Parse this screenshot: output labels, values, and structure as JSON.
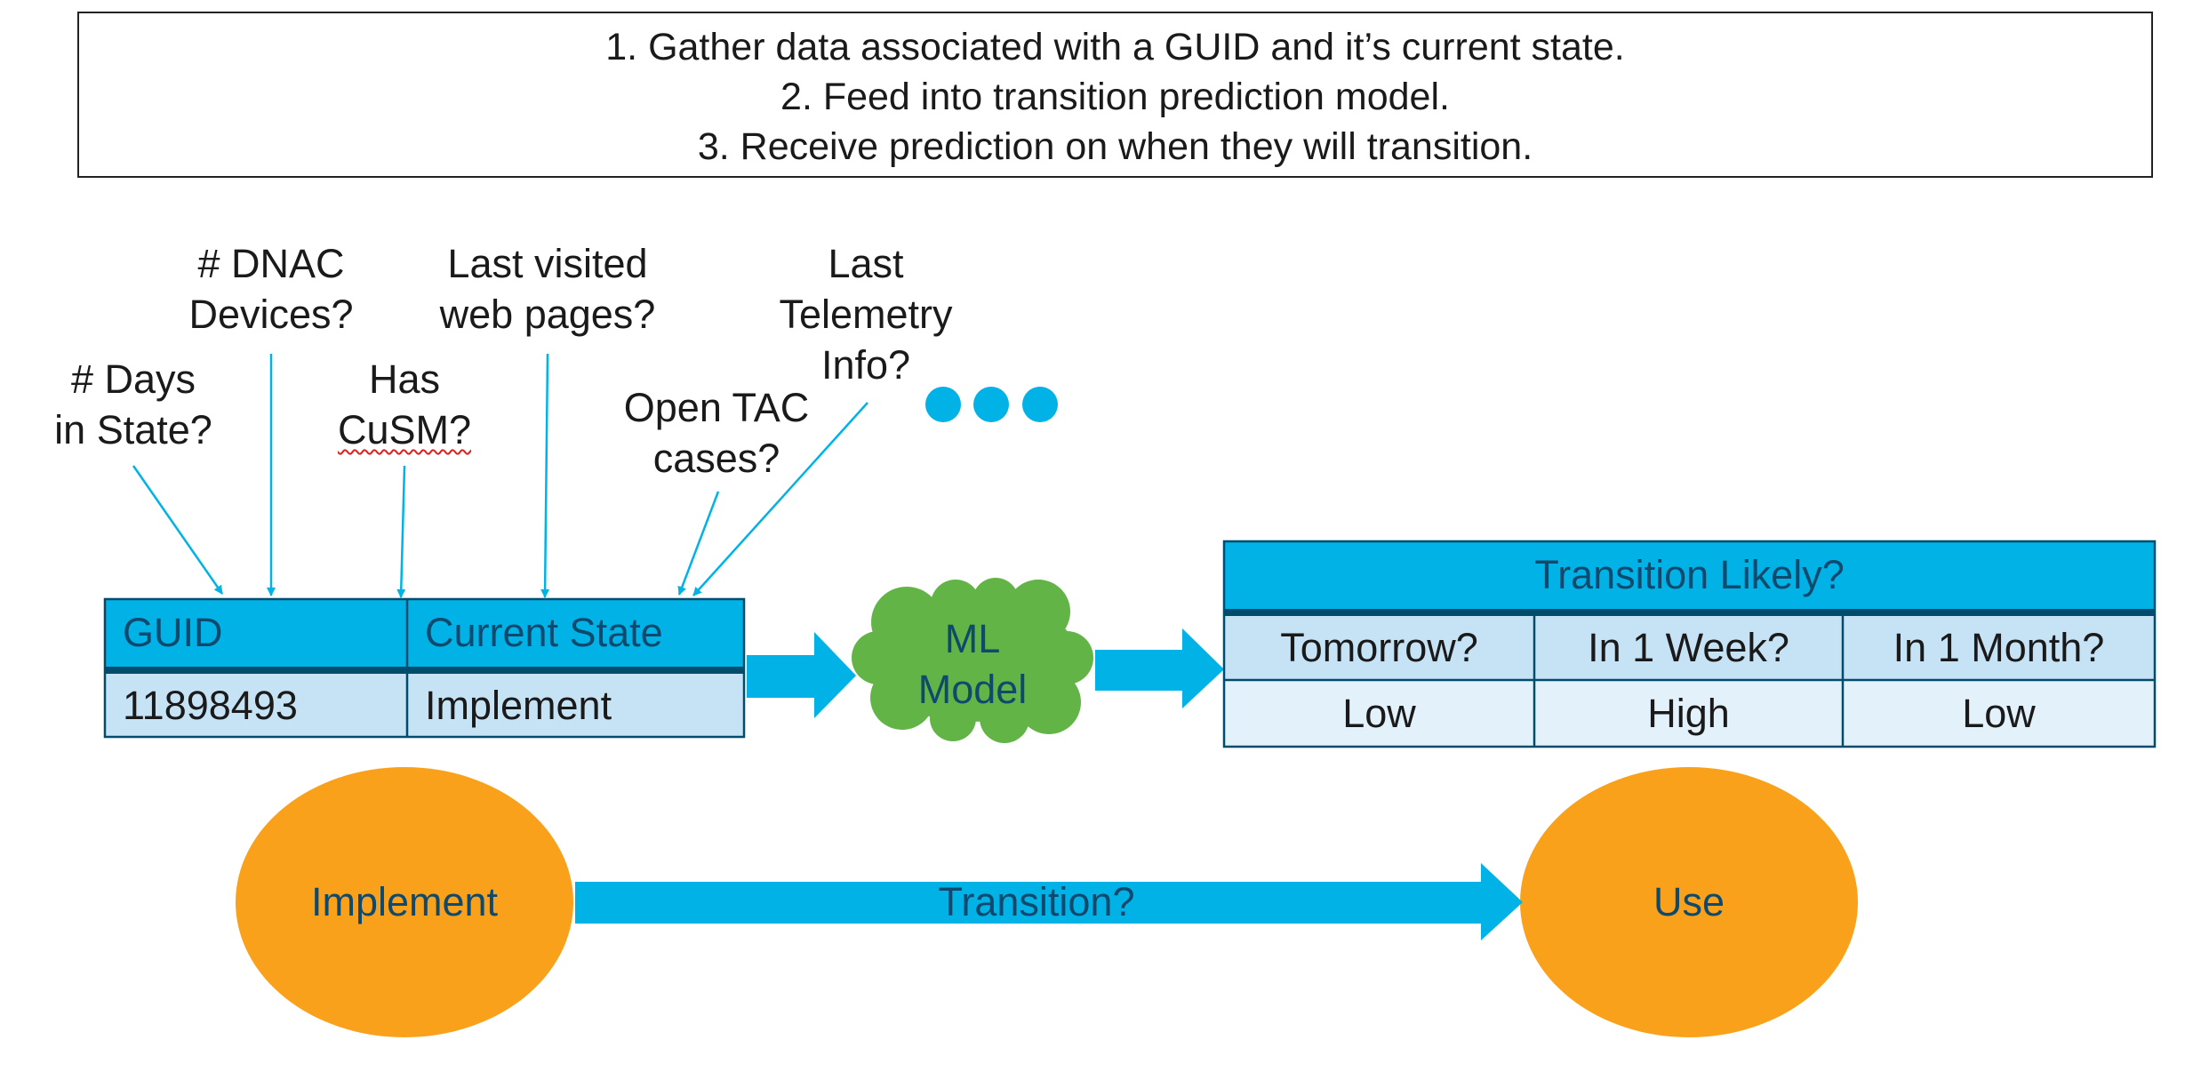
{
  "steps": [
    "1. Gather data associated with a GUID and it’s current state.",
    "2. Feed into transition prediction model.",
    "3. Receive prediction on when they will transition."
  ],
  "features": {
    "days_in_state": [
      "# Days",
      "in State?"
    ],
    "dnac_devices": [
      "# DNAC",
      "Devices?"
    ],
    "has_cusm": [
      "Has",
      "CuSM?"
    ],
    "web_pages": [
      "Last visited",
      "web pages?"
    ],
    "tac_cases": [
      "Open TAC",
      "cases?"
    ],
    "telemetry": [
      "Last",
      "Telemetry",
      "Info?"
    ],
    "more_icon": "ellipsis-dots"
  },
  "input_table": {
    "headers": [
      "GUID",
      "Current State"
    ],
    "row": [
      "11898493",
      "Implement"
    ]
  },
  "model": [
    "ML",
    "Model"
  ],
  "output_table": {
    "title": "Transition Likely?",
    "headers": [
      "Tomorrow?",
      "In 1 Week?",
      "In 1 Month?"
    ],
    "row": [
      "Low",
      "High",
      "Low"
    ]
  },
  "states": {
    "from": "Implement",
    "to": "Use",
    "arrow_label": "Transition?"
  },
  "colors": {
    "cyan": "#00b2e6",
    "dark_rule": "#004c6c",
    "light_blue": "#c6e2f5",
    "lighter_blue": "#e3f1fa",
    "cloud_green": "#62b446",
    "state_orange": "#f9a11b",
    "label_navy": "#0f4a6e"
  }
}
